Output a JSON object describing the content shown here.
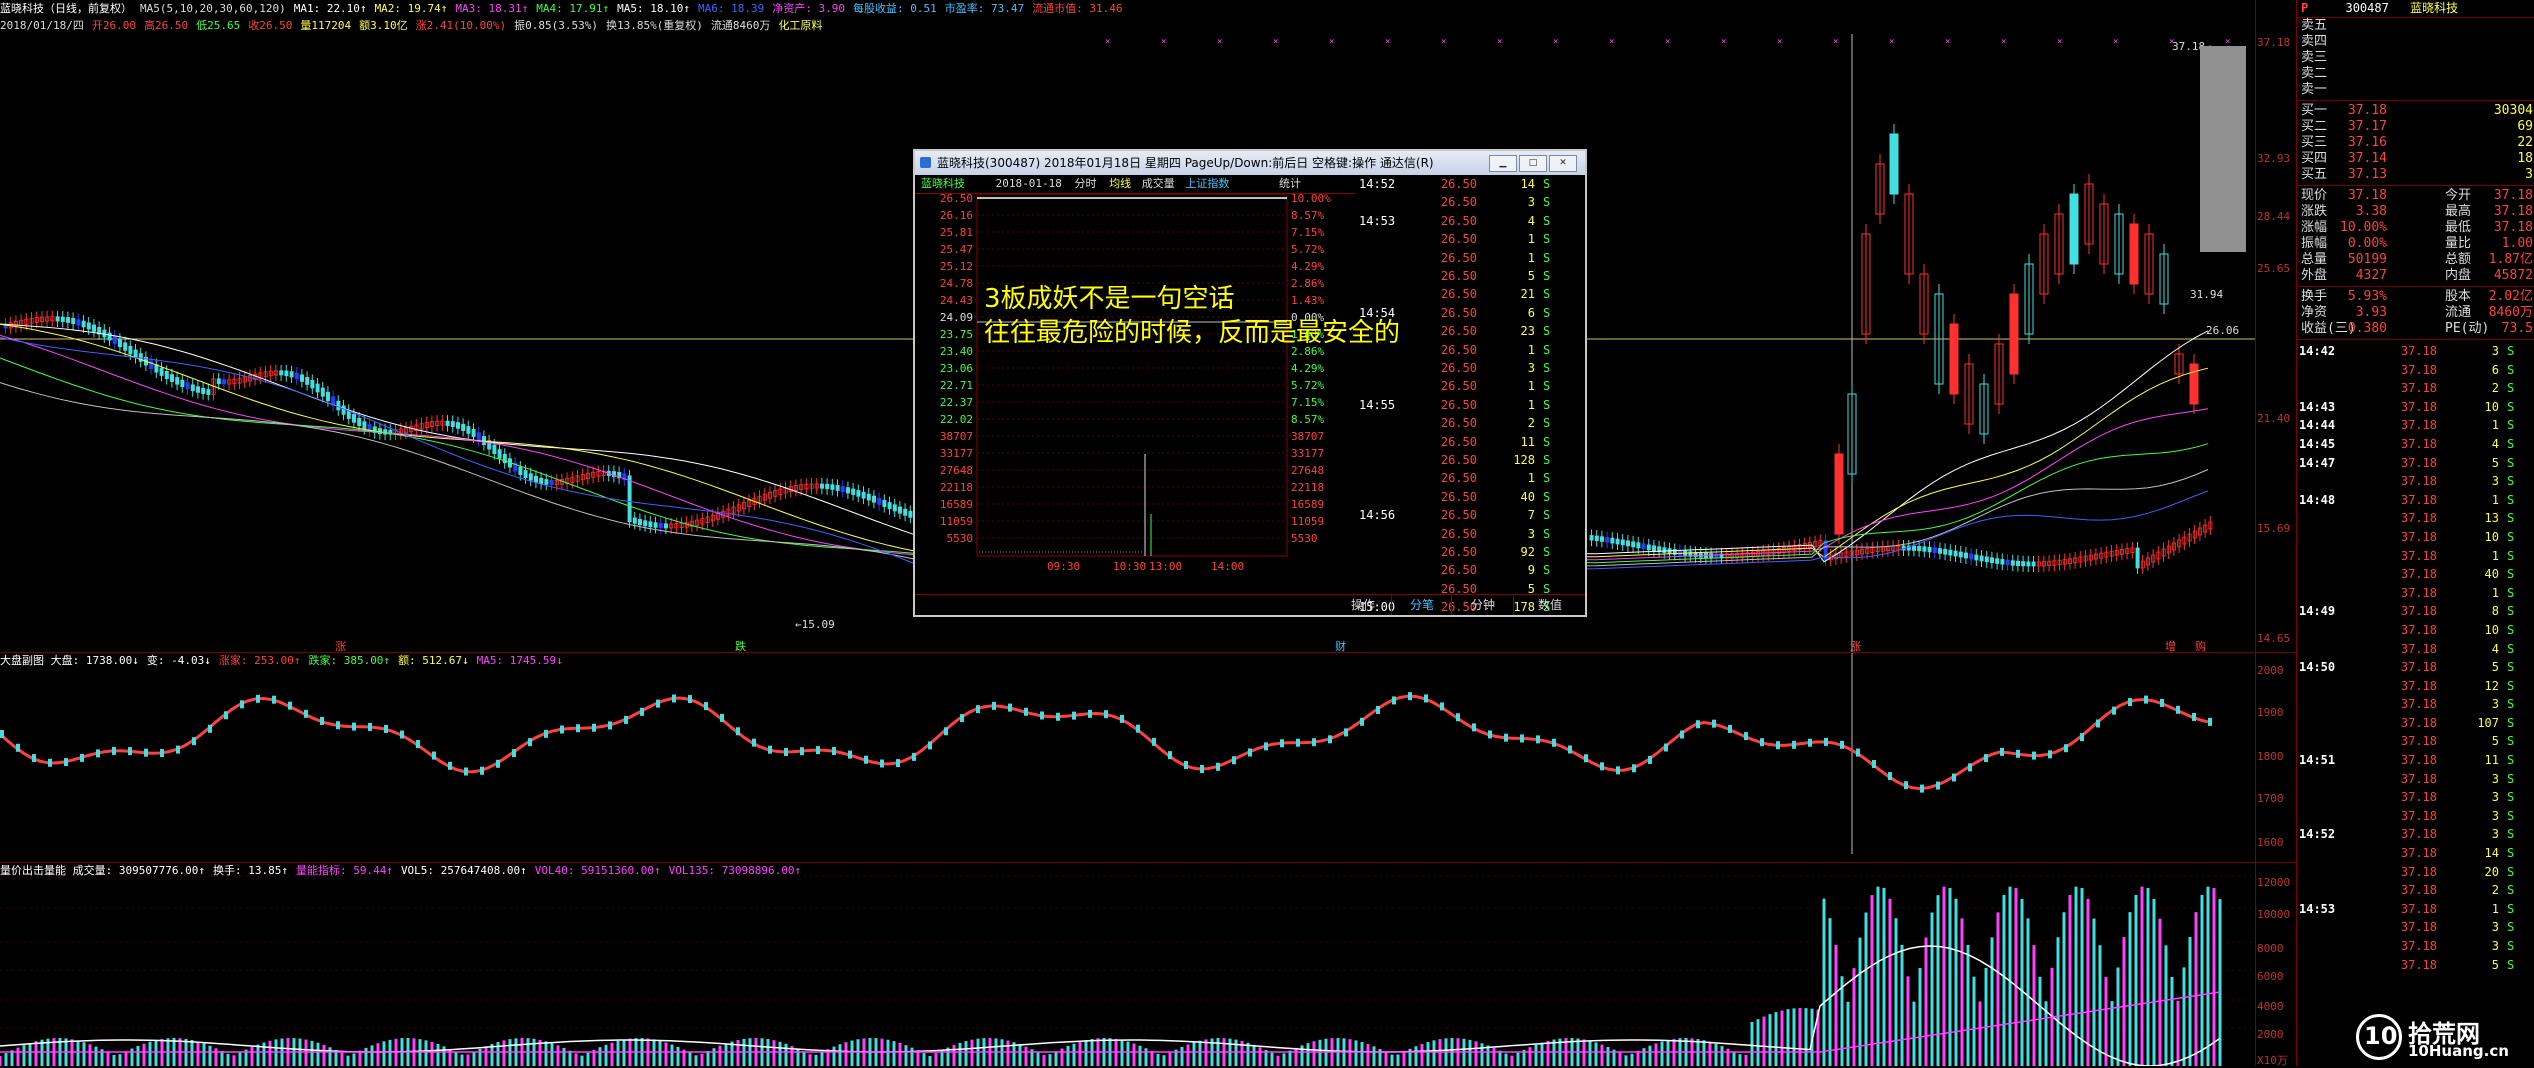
{
  "info": {
    "line1": [
      "蓝晓科技（日线，前复权）",
      "MA5(5,10,20,30,60,120)",
      "MA1: 22.10↑",
      "MA2: 19.74↑",
      "MA3: 18.31↑",
      "MA4: 17.91↑",
      "MA5: 18.10↑",
      "MA6: 18.39",
      "净资产: 3.90",
      "每股收益: 0.51",
      "市盈率: 73.47",
      "流通市值: 31.46"
    ],
    "line2": [
      "2018/01/18/四",
      "开26.00",
      "高26.50",
      "低25.65",
      "收26.50",
      "量117204",
      "额3.10亿",
      "涨2.41(10.00%)",
      "振0.85(3.53%)",
      "换13.85%(重复权)",
      "流通8460万",
      "化工原料"
    ]
  },
  "main_axis": [
    "37.18",
    "32.93",
    "28.44",
    "25.65",
    "21.40",
    "15.69",
    "14.65"
  ],
  "main_chart": {
    "hline_price": "26.06",
    "low_marker": "15.09",
    "high_marker": "37.18",
    "cursor_price": "31.94",
    "bottom_marks": [
      "涨",
      "跌",
      "财",
      "涨",
      "增",
      "购"
    ]
  },
  "panel2": {
    "header": [
      "大盘副图 大盘: 1738.00↓",
      "变: -4.03↓",
      "涨家: 253.00↑",
      "跌家: 385.00↑",
      "额: 512.67↓",
      "MA5: 1745.59↓"
    ],
    "axis": [
      "2000",
      "1900",
      "1800",
      "1700",
      "1600"
    ]
  },
  "panel3": {
    "header": [
      "量价出击量能 成交量: 309507776.00↑",
      "换手: 13.85↑",
      "量能指标: 59.44↑",
      "VOL5: 257647408.00↑",
      "VOL40: 59151360.00↑",
      "VOL135: 73098896.00↑"
    ],
    "axis": [
      "12000",
      "10000",
      "8000",
      "6000",
      "4000",
      "2000",
      "X10万"
    ]
  },
  "quote": {
    "p": "P",
    "code": "300487",
    "name": "蓝晓科技",
    "sell": [
      "卖五",
      "卖四",
      "卖三",
      "卖二",
      "卖一"
    ],
    "buy": [
      {
        "label": "买一",
        "price": "37.18",
        "vol": "30304"
      },
      {
        "label": "买二",
        "price": "37.17",
        "vol": "69"
      },
      {
        "label": "买三",
        "price": "37.16",
        "vol": "22"
      },
      {
        "label": "买四",
        "price": "37.14",
        "vol": "18"
      },
      {
        "label": "买五",
        "price": "37.13",
        "vol": "3"
      }
    ],
    "stats": [
      {
        "l1": "现价",
        "v1": "37.18",
        "l2": "今开",
        "v2": "37.18"
      },
      {
        "l1": "涨跌",
        "v1": "3.38",
        "l2": "最高",
        "v2": "37.18"
      },
      {
        "l1": "涨幅",
        "v1": "10.00%",
        "l2": "最低",
        "v2": "37.18"
      },
      {
        "l1": "振幅",
        "v1": "0.00%",
        "l2": "量比",
        "v2": "1.00"
      },
      {
        "l1": "总量",
        "v1": "50199",
        "l2": "总额",
        "v2": "1.87亿"
      },
      {
        "l1": "外盘",
        "v1": "4327",
        "l2": "内盘",
        "v2": "45872"
      }
    ],
    "stats2": [
      {
        "l1": "换手",
        "v1": "5.93%",
        "l2": "股本",
        "v2": "2.02亿"
      },
      {
        "l1": "净资",
        "v1": "3.93",
        "l2": "流通",
        "v2": "8460万"
      },
      {
        "l1": "收益(三)",
        "v1": "0.380",
        "l2": "PE(动)",
        "v2": "73.5"
      }
    ],
    "ticks": [
      {
        "t": "14:42",
        "p": "37.18",
        "v": "3",
        "f": "S"
      },
      {
        "t": "",
        "p": "37.18",
        "v": "6",
        "f": "S"
      },
      {
        "t": "",
        "p": "37.18",
        "v": "2",
        "f": "S"
      },
      {
        "t": "14:43",
        "p": "37.18",
        "v": "10",
        "f": "S"
      },
      {
        "t": "14:44",
        "p": "37.18",
        "v": "1",
        "f": "S"
      },
      {
        "t": "14:45",
        "p": "37.18",
        "v": "4",
        "f": "S"
      },
      {
        "t": "14:47",
        "p": "37.18",
        "v": "5",
        "f": "S"
      },
      {
        "t": "",
        "p": "37.18",
        "v": "3",
        "f": "S"
      },
      {
        "t": "14:48",
        "p": "37.18",
        "v": "1",
        "f": "S"
      },
      {
        "t": "",
        "p": "37.18",
        "v": "13",
        "f": "S"
      },
      {
        "t": "",
        "p": "37.18",
        "v": "10",
        "f": "S"
      },
      {
        "t": "",
        "p": "37.18",
        "v": "1",
        "f": "S"
      },
      {
        "t": "",
        "p": "37.18",
        "v": "40",
        "f": "S"
      },
      {
        "t": "",
        "p": "37.18",
        "v": "1",
        "f": "S"
      },
      {
        "t": "14:49",
        "p": "37.18",
        "v": "8",
        "f": "S"
      },
      {
        "t": "",
        "p": "37.18",
        "v": "10",
        "f": "S"
      },
      {
        "t": "",
        "p": "37.18",
        "v": "4",
        "f": "S"
      },
      {
        "t": "14:50",
        "p": "37.18",
        "v": "5",
        "f": "S"
      },
      {
        "t": "",
        "p": "37.18",
        "v": "12",
        "f": "S"
      },
      {
        "t": "",
        "p": "37.18",
        "v": "3",
        "f": "S"
      },
      {
        "t": "",
        "p": "37.18",
        "v": "107",
        "f": "S"
      },
      {
        "t": "",
        "p": "37.18",
        "v": "5",
        "f": "S"
      },
      {
        "t": "14:51",
        "p": "37.18",
        "v": "11",
        "f": "S"
      },
      {
        "t": "",
        "p": "37.18",
        "v": "3",
        "f": "S"
      },
      {
        "t": "",
        "p": "37.18",
        "v": "3",
        "f": "S"
      },
      {
        "t": "",
        "p": "37.18",
        "v": "3",
        "f": "S"
      },
      {
        "t": "14:52",
        "p": "37.18",
        "v": "3",
        "f": "S"
      },
      {
        "t": "",
        "p": "37.18",
        "v": "14",
        "f": "S"
      },
      {
        "t": "",
        "p": "37.18",
        "v": "20",
        "f": "S"
      },
      {
        "t": "",
        "p": "37.18",
        "v": "2",
        "f": "S"
      },
      {
        "t": "14:53",
        "p": "37.18",
        "v": "1",
        "f": "S"
      },
      {
        "t": "",
        "p": "37.18",
        "v": "3",
        "f": "S"
      },
      {
        "t": "",
        "p": "37.18",
        "v": "3",
        "f": "S"
      },
      {
        "t": "",
        "p": "37.18",
        "v": "5",
        "f": "S"
      }
    ]
  },
  "popup": {
    "title": "蓝晓科技(300487) 2018年01月18日 星期四 PageUp/Down:前后日 空格键:操作 通达信(R)",
    "head_name": "蓝晓科技",
    "head_date": "2018-01-18",
    "head_items": [
      "分时",
      "均线",
      "成交量",
      "上证指数"
    ],
    "head_right": "统计",
    "left_axis": [
      "26.50",
      "26.16",
      "25.81",
      "25.47",
      "25.12",
      "24.78",
      "24.43",
      "24.09",
      "23.75",
      "23.40",
      "23.06",
      "22.71",
      "22.37",
      "22.02",
      "38707",
      "33177",
      "27648",
      "22118",
      "16589",
      "11059",
      "5530"
    ],
    "right_axis": [
      "10.00%",
      "8.57%",
      "7.15%",
      "5.72%",
      "4.29%",
      "2.86%",
      "1.43%",
      "0.00%",
      "1.43%",
      "2.86%",
      "4.29%",
      "5.72%",
      "7.15%",
      "8.57%",
      "38707",
      "33177",
      "27648",
      "22118",
      "16589",
      "11059",
      "5530"
    ],
    "time_axis": [
      "09:30",
      "10:30",
      "13:00",
      "14:00"
    ],
    "ticks": [
      {
        "t": "14:52",
        "p": "26.50",
        "v": "14",
        "f": "S"
      },
      {
        "t": "",
        "p": "26.50",
        "v": "3",
        "f": "S"
      },
      {
        "t": "14:53",
        "p": "26.50",
        "v": "4",
        "f": "S"
      },
      {
        "t": "",
        "p": "26.50",
        "v": "1",
        "f": "S"
      },
      {
        "t": "",
        "p": "26.50",
        "v": "1",
        "f": "S"
      },
      {
        "t": "",
        "p": "26.50",
        "v": "5",
        "f": "S"
      },
      {
        "t": "",
        "p": "26.50",
        "v": "21",
        "f": "S"
      },
      {
        "t": "14:54",
        "p": "26.50",
        "v": "6",
        "f": "S"
      },
      {
        "t": "",
        "p": "26.50",
        "v": "23",
        "f": "S"
      },
      {
        "t": "",
        "p": "26.50",
        "v": "1",
        "f": "S"
      },
      {
        "t": "",
        "p": "26.50",
        "v": "3",
        "f": "S"
      },
      {
        "t": "",
        "p": "26.50",
        "v": "1",
        "f": "S"
      },
      {
        "t": "14:55",
        "p": "26.50",
        "v": "1",
        "f": "S"
      },
      {
        "t": "",
        "p": "26.50",
        "v": "2",
        "f": "S"
      },
      {
        "t": "",
        "p": "26.50",
        "v": "11",
        "f": "S"
      },
      {
        "t": "",
        "p": "26.50",
        "v": "128",
        "f": "S"
      },
      {
        "t": "",
        "p": "26.50",
        "v": "1",
        "f": "S"
      },
      {
        "t": "",
        "p": "26.50",
        "v": "40",
        "f": "S"
      },
      {
        "t": "14:56",
        "p": "26.50",
        "v": "7",
        "f": "S"
      },
      {
        "t": "",
        "p": "26.50",
        "v": "3",
        "f": "S"
      },
      {
        "t": "",
        "p": "26.50",
        "v": "92",
        "f": "S"
      },
      {
        "t": "",
        "p": "26.50",
        "v": "9",
        "f": "S"
      },
      {
        "t": "",
        "p": "26.50",
        "v": "5",
        "f": "S"
      },
      {
        "t": "15:00",
        "p": "26.50",
        "v": "178",
        "f": "S"
      }
    ],
    "tabs": [
      "操作",
      "分笔",
      "分钟",
      "数值"
    ]
  },
  "overlay": {
    "line1": "3板成妖不是一句空话",
    "line2": "往往最危险的时候，反而是最安全的"
  },
  "watermark": {
    "number": "10",
    "text": "拾荒网",
    "url": "10Huang.cn"
  }
}
